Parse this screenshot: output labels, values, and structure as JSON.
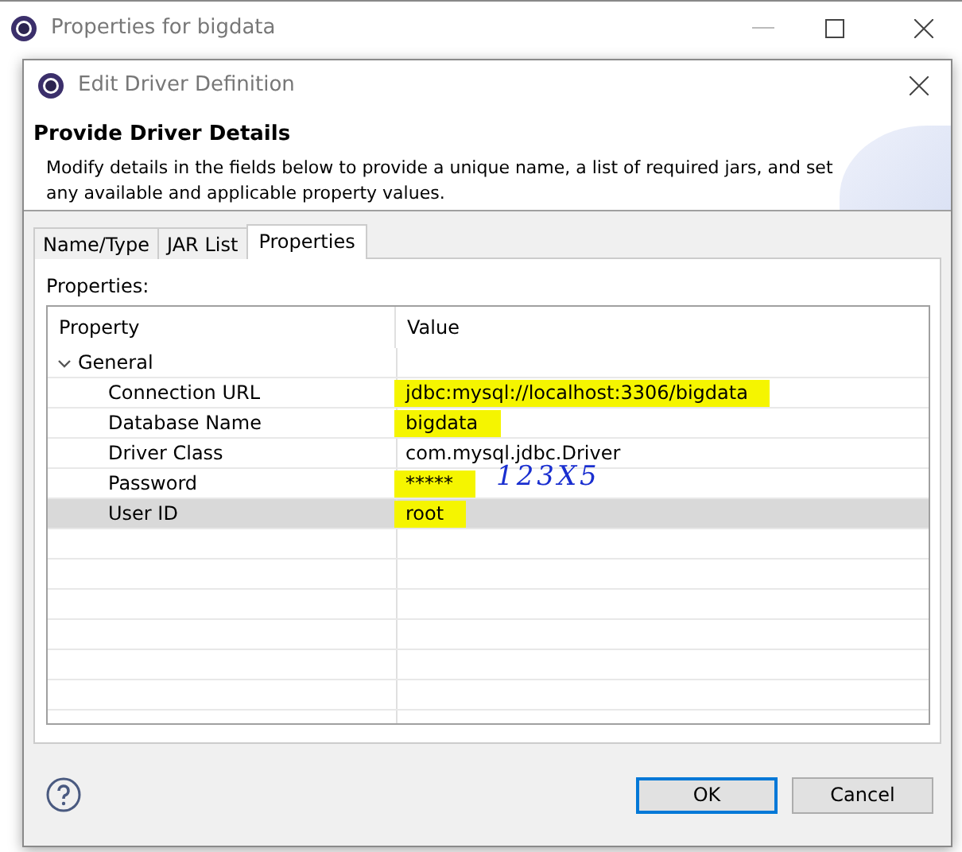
{
  "background_window": {
    "title": "Properties for bigdata"
  },
  "dialog": {
    "title": "Edit Driver Definition",
    "heading": "Provide Driver Details",
    "description": "Modify details in the fields below to provide a unique name, a list of required jars, and set any available and applicable property values.",
    "tabs": [
      {
        "label": "Name/Type",
        "selected": false
      },
      {
        "label": "JAR List",
        "selected": false
      },
      {
        "label": "Properties",
        "selected": true
      }
    ],
    "properties_label": "Properties:",
    "table": {
      "columns": [
        "Property",
        "Value"
      ],
      "group": {
        "label": "General",
        "expanded": true
      },
      "rows": [
        {
          "property": "Connection URL",
          "value": "jdbc:mysql://localhost:3306/bigdata",
          "selected": false,
          "highlighted": true
        },
        {
          "property": "Database Name",
          "value": "bigdata",
          "selected": false,
          "highlighted": true
        },
        {
          "property": "Driver Class",
          "value": "com.mysql.jdbc.Driver",
          "selected": false,
          "highlighted": false
        },
        {
          "property": "Password",
          "value": "*****",
          "selected": false,
          "highlighted": true,
          "annotation": "123X5"
        },
        {
          "property": "User ID",
          "value": "root",
          "selected": true,
          "highlighted": true
        }
      ]
    },
    "buttons": [
      {
        "label": "OK",
        "default": true
      },
      {
        "label": "Cancel",
        "default": false
      }
    ]
  }
}
